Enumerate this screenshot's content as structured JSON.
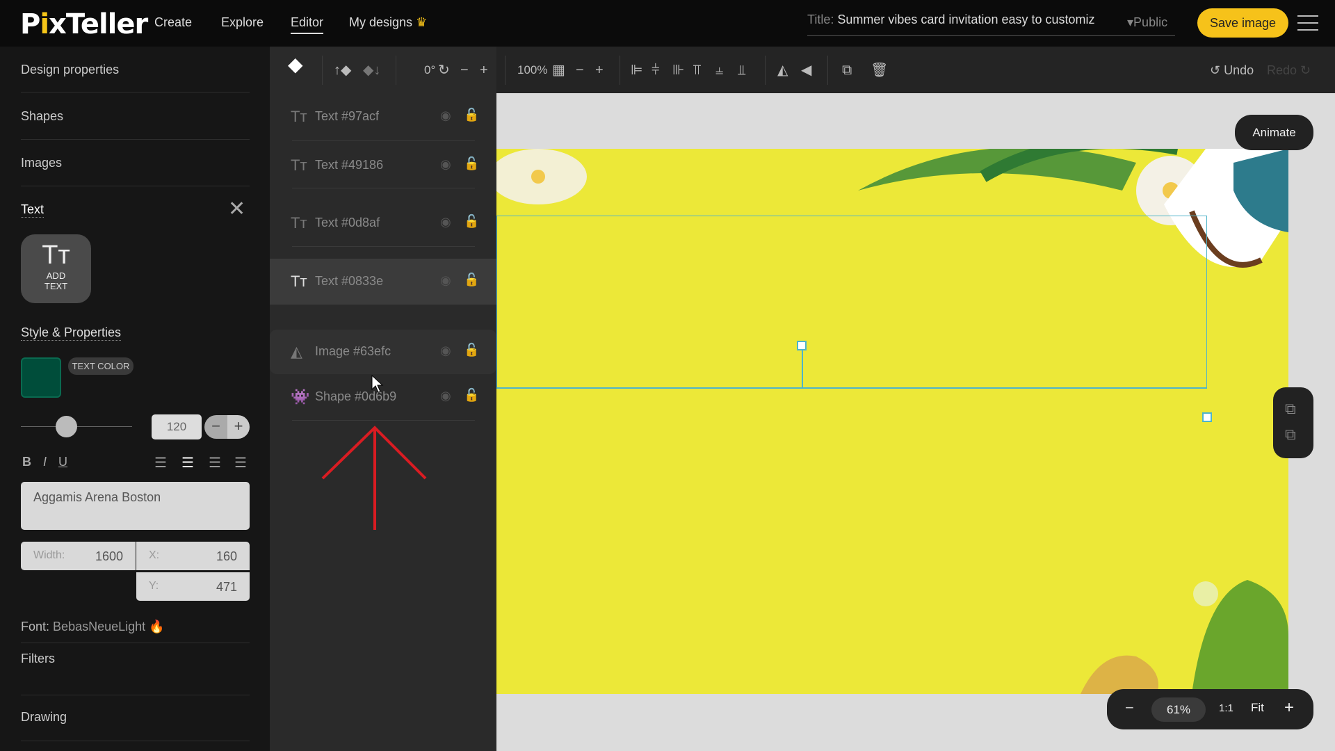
{
  "header": {
    "logo": "PixTeller",
    "nav": [
      "Create",
      "Explore",
      "Editor",
      "My designs"
    ],
    "active_nav": "Editor",
    "title_label": "Title:",
    "title_value": "Summer vibes card invitation easy to customiz",
    "visibility": "Public",
    "save_label": "Save image"
  },
  "toolbar": {
    "rotation": "0°",
    "opacity": "100%",
    "undo": "Undo",
    "redo": "Redo"
  },
  "left_panel": {
    "sections": [
      "Design properties",
      "Shapes",
      "Images",
      "Text"
    ],
    "add_text": "ADD TEXT",
    "style_title": "Style & Properties",
    "text_color_label": "TEXT COLOR",
    "text_color": "#004d3a",
    "font_size": "120",
    "font_size_slider_percent": 35,
    "text_value": "Aggamis Arena Boston",
    "width_label": "Width:",
    "width": "1600",
    "x_label": "X:",
    "x": "160",
    "y_label": "Y:",
    "y": "471",
    "font_label": "Font:",
    "font_name": "BebasNeueLight",
    "filters": "Filters",
    "drawing": "Drawing"
  },
  "layers": [
    {
      "type": "text",
      "name": "Text #97acf"
    },
    {
      "type": "text",
      "name": "Text #49186"
    },
    {
      "type": "text",
      "name": "Text #0d8af"
    },
    {
      "type": "text",
      "name": "Text #0833e",
      "selected": true
    },
    {
      "type": "image",
      "name": "Image #63efc",
      "hovered": true
    },
    {
      "type": "shape",
      "name": "Shape #0d6b9"
    }
  ],
  "canvas": {
    "animate": "Animate",
    "zoom": "61%",
    "one_to_one": "1:1",
    "fit": "Fit",
    "background_color": "#ece838"
  },
  "colors": {
    "accent": "#f6c21a",
    "selection": "#4fb4c9",
    "annotation_arrow": "#d91c22"
  }
}
